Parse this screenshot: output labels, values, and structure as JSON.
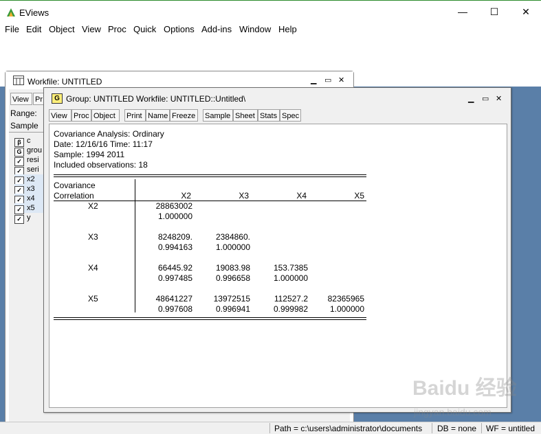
{
  "app": {
    "title": "EViews",
    "minimize": "—",
    "maximize": "☐",
    "close": "✕"
  },
  "menu": [
    "File",
    "Edit",
    "Object",
    "View",
    "Proc",
    "Quick",
    "Options",
    "Add-ins",
    "Window",
    "Help"
  ],
  "workfile": {
    "title": "Workfile: UNTITLED",
    "btn_view": "View",
    "btn_pr": "Pr",
    "range_label": "Range:",
    "sample_label": "Sample",
    "items": [
      {
        "icon": "β",
        "name": "c"
      },
      {
        "icon": "G",
        "name": "grou"
      },
      {
        "icon": "✓",
        "name": "resi"
      },
      {
        "icon": "✓",
        "name": "seri"
      },
      {
        "icon": "✓",
        "name": "x2"
      },
      {
        "icon": "✓",
        "name": "x3"
      },
      {
        "icon": "✓",
        "name": "x4"
      },
      {
        "icon": "✓",
        "name": "x5"
      },
      {
        "icon": "✓",
        "name": "y"
      }
    ]
  },
  "group": {
    "icon": "G",
    "title": "Group: UNTITLED   Workfile: UNTITLED::Untitled\\",
    "toolbar": [
      "View",
      "Proc",
      "Object",
      "Print",
      "Name",
      "Freeze",
      "Sample",
      "Sheet",
      "Stats",
      "Spec"
    ],
    "header_lines": [
      "Covariance Analysis: Ordinary",
      "Date: 12/16/16   Time: 11:17",
      "Sample: 1994 2011",
      "Included observations: 18"
    ],
    "table_label1": "Covariance",
    "table_label2": "Correlation",
    "columns": [
      "X2",
      "X3",
      "X4",
      "X5"
    ],
    "rows": [
      {
        "label": "X2",
        "cov": [
          "28863002",
          "",
          "",
          ""
        ],
        "cor": [
          "1.000000",
          "",
          "",
          ""
        ]
      },
      {
        "label": "X3",
        "cov": [
          "8248209.",
          "2384860.",
          "",
          ""
        ],
        "cor": [
          "0.994163",
          "1.000000",
          "",
          ""
        ]
      },
      {
        "label": "X4",
        "cov": [
          "66445.92",
          "19083.98",
          "153.7385",
          ""
        ],
        "cor": [
          "0.997485",
          "0.996658",
          "1.000000",
          ""
        ]
      },
      {
        "label": "X5",
        "cov": [
          "48641227",
          "13972515",
          "112527.2",
          "82365965"
        ],
        "cor": [
          "0.997608",
          "0.996941",
          "0.999982",
          "1.000000"
        ]
      }
    ]
  },
  "status": {
    "path": "Path = c:\\users\\administrator\\documents",
    "db": "DB = none",
    "wf": "WF = untitled"
  },
  "watermark": {
    "text1": "Baidu 经验",
    "text2": "jingyan.baidu.com"
  },
  "colors": {
    "mdi_bg": "#5a7fa8",
    "accent_green": "#2a8a2a",
    "group_icon": "#ffef7a"
  }
}
